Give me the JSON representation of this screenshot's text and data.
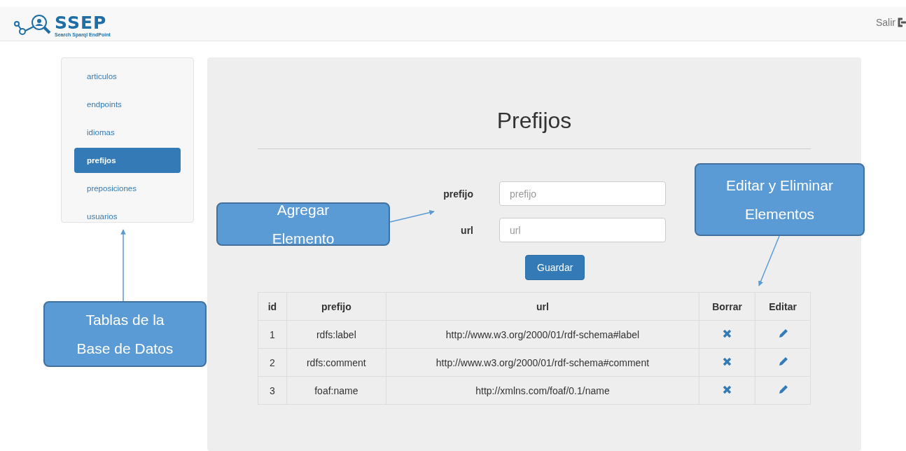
{
  "navbar": {
    "logo_title": "SSEP",
    "logo_subtitle": "Search Sparql EndPoint",
    "logout": "Salir"
  },
  "sidebar": {
    "items": [
      {
        "label": "articulos",
        "selected": false
      },
      {
        "label": "endpoints",
        "selected": false
      },
      {
        "label": "idiomas",
        "selected": false
      },
      {
        "label": "prefijos",
        "selected": true
      },
      {
        "label": "preposiciones",
        "selected": false
      },
      {
        "label": "usuarios",
        "selected": false
      }
    ]
  },
  "main": {
    "title": "Prefijos",
    "form": {
      "fields": [
        {
          "label": "prefijo",
          "placeholder": "prefijo"
        },
        {
          "label": "url",
          "placeholder": "url"
        }
      ],
      "submit": "Guardar"
    },
    "table": {
      "columns": [
        "id",
        "prefijo",
        "url",
        "Borrar",
        "Editar"
      ],
      "rows": [
        {
          "id": "1",
          "prefijo": "rdfs:label",
          "url": "http://www.w3.org/2000/01/rdf-schema#label"
        },
        {
          "id": "2",
          "prefijo": "rdfs:comment",
          "url": "http://www.w3.org/2000/01/rdf-schema#comment"
        },
        {
          "id": "3",
          "prefijo": "foaf:name",
          "url": "http://xmlns.com/foaf/0.1/name"
        }
      ]
    }
  },
  "callouts": [
    {
      "text": "Agregar Elemento"
    },
    {
      "text": "Editar y Eliminar Elementos"
    },
    {
      "text": "Tablas de la Base de Datos"
    }
  ]
}
